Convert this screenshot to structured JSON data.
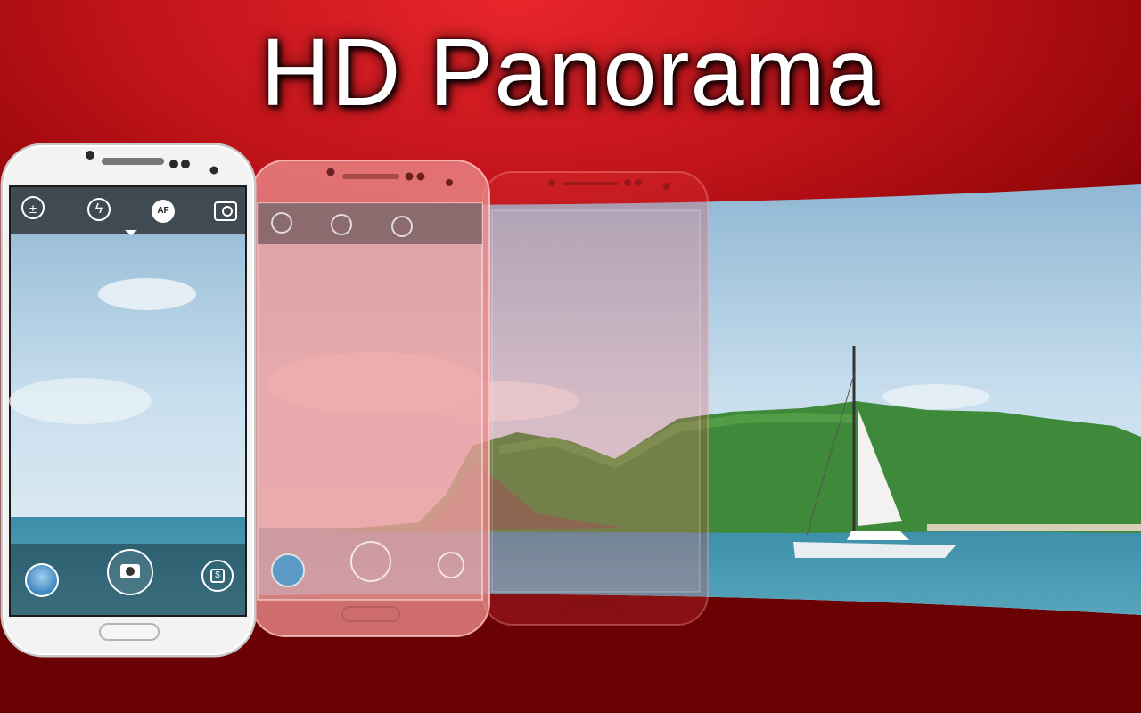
{
  "banner": {
    "title": "HD Panorama"
  },
  "camera_ui": {
    "top_controls": [
      "exposure-icon",
      "flash-auto-icon",
      "autofocus-icon",
      "switch-camera-icon"
    ],
    "autofocus_label": "AF",
    "bottom_controls": [
      "gallery-thumbnail",
      "shutter-button",
      "mode-button"
    ]
  },
  "colors": {
    "background": "#b5121a",
    "phone_white": "#f4f4f4",
    "phone_pink": "#e79a9a",
    "sea": "#4a98b0",
    "sky": "#b9d6ea"
  }
}
